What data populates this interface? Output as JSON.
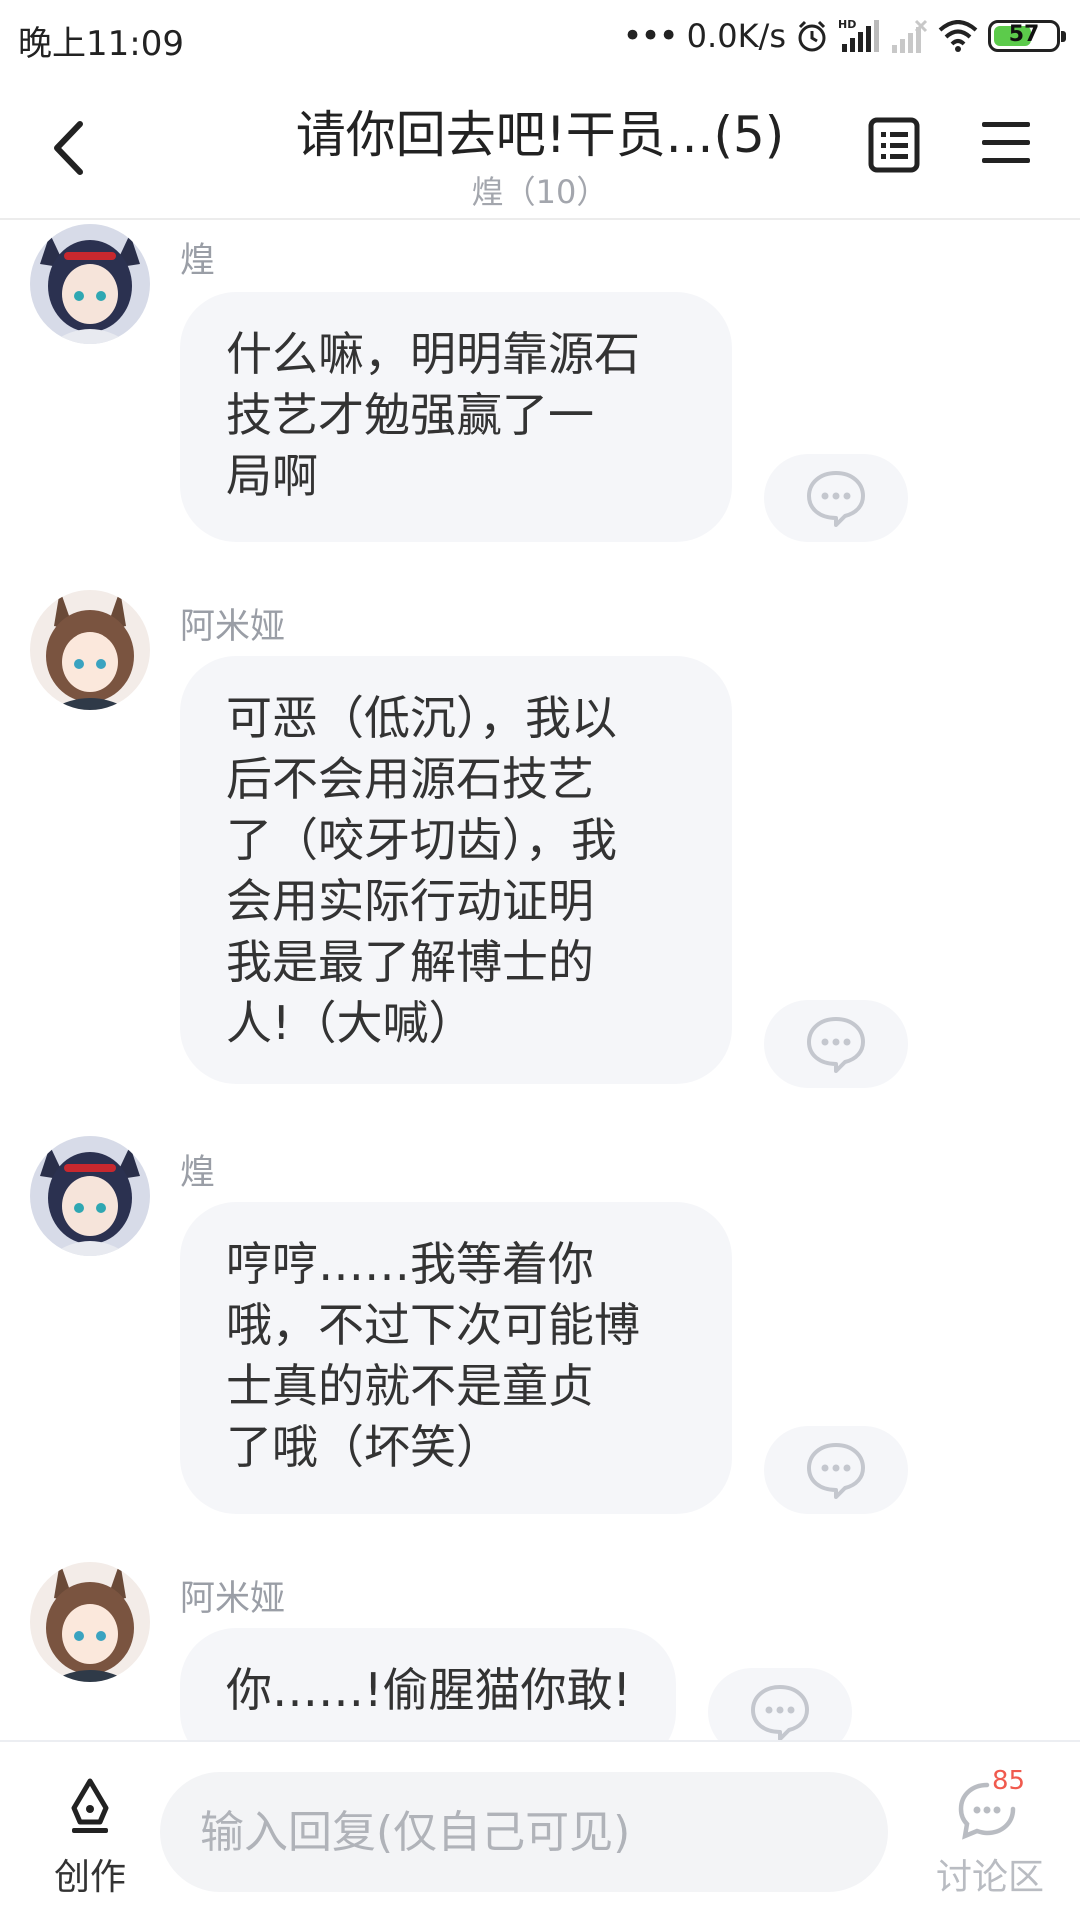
{
  "status_bar": {
    "time": "晚上11:09",
    "network_speed": "0.0K/s",
    "battery_level": "57",
    "icons": [
      "more-dots-icon",
      "alarm-icon",
      "hd-signal-icon",
      "no-signal-icon",
      "wifi-icon",
      "battery-icon"
    ]
  },
  "header": {
    "title": "请你回去吧!干员...(5)",
    "subtitle": "煌（10）",
    "back_icon": "chevron-left-icon",
    "list_icon": "list-icon",
    "menu_icon": "menu-icon"
  },
  "messages": [
    {
      "sender": "煌",
      "avatar": "avatar-huang",
      "lines": [
        "什么嘛，明明靠源石",
        "技艺才勉强赢了一",
        "局啊"
      ]
    },
    {
      "sender": "阿米娅",
      "avatar": "avatar-amiya",
      "lines": [
        "可恶（低沉），我以",
        "后不会用源石技艺",
        "了（咬牙切齿），我",
        "会用实际行动证明",
        "我是最了解博士的",
        "人!（大喊）"
      ]
    },
    {
      "sender": "煌",
      "avatar": "avatar-huang",
      "lines": [
        "哼哼……我等着你",
        "哦，不过下次可能博",
        "士真的就不是童贞",
        "了哦（坏笑）"
      ]
    },
    {
      "sender": "阿米娅",
      "avatar": "avatar-amiya",
      "lines": [
        "你……!偷腥猫你敢!"
      ]
    }
  ],
  "bottom_bar": {
    "create_label": "创作",
    "reply_placeholder": "输入回复(仅自己可见)",
    "discuss_label": "讨论区",
    "discuss_count": "85"
  },
  "colors": {
    "bubble_bg": "#f5f6f9",
    "muted_text": "#9a9ea6",
    "badge": "#f05a4e",
    "battery_fill": "#5ccb4b"
  }
}
